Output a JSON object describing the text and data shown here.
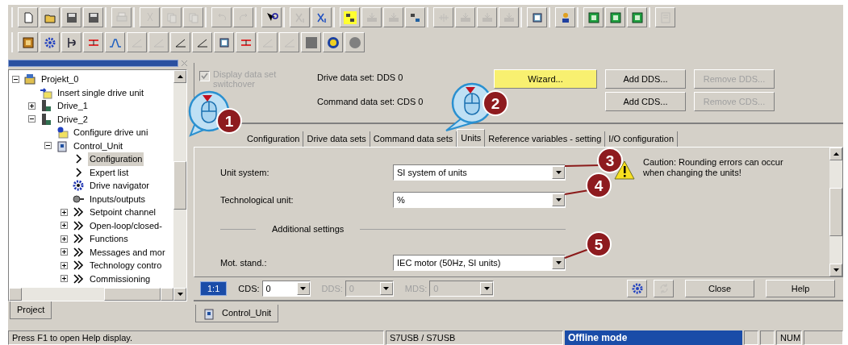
{
  "toolbars": [
    {
      "groups": [
        [
          {
            "kind": "new",
            "disabled": false
          },
          {
            "kind": "open",
            "disabled": false
          },
          {
            "kind": "save",
            "disabled": false
          },
          {
            "kind": "saveall",
            "disabled": false
          }
        ],
        [
          {
            "kind": "print",
            "disabled": true
          }
        ],
        [
          {
            "kind": "cut",
            "disabled": true
          },
          {
            "kind": "copy",
            "disabled": true
          },
          {
            "kind": "paste",
            "disabled": true
          }
        ],
        [
          {
            "kind": "undo",
            "disabled": true
          },
          {
            "kind": "redo",
            "disabled": true
          }
        ],
        [
          {
            "kind": "help",
            "disabled": false
          }
        ],
        [
          {
            "kind": "xi",
            "disabled": true
          },
          {
            "kind": "xe",
            "disabled": false
          }
        ],
        [
          {
            "kind": "connect",
            "disabled": false
          },
          {
            "kind": "download",
            "disabled": true
          },
          {
            "kind": "upload",
            "disabled": true
          },
          {
            "kind": "online",
            "disabled": false
          }
        ],
        [
          {
            "kind": "pins",
            "disabled": true
          },
          {
            "kind": "download",
            "disabled": true
          },
          {
            "kind": "upload",
            "disabled": true
          },
          {
            "kind": "download",
            "disabled": true
          }
        ],
        [
          {
            "kind": "chip",
            "disabled": false
          }
        ],
        [
          {
            "kind": "person",
            "disabled": false
          }
        ],
        [
          {
            "kind": "green",
            "disabled": false
          },
          {
            "kind": "green",
            "disabled": false
          },
          {
            "kind": "green",
            "disabled": false
          }
        ],
        [
          {
            "kind": "panel",
            "disabled": true
          }
        ]
      ]
    },
    {
      "groups": [
        [
          {
            "kind": "module",
            "disabled": false
          },
          {
            "kind": "gear",
            "disabled": false
          },
          {
            "kind": "valve",
            "disabled": false
          },
          {
            "kind": "redbar",
            "disabled": false
          },
          {
            "kind": "trapezoid",
            "disabled": false
          },
          {
            "kind": "ramp",
            "disabled": true
          },
          {
            "kind": "ramp",
            "disabled": true
          },
          {
            "kind": "ramp",
            "disabled": false
          },
          {
            "kind": "ramp",
            "disabled": false
          },
          {
            "kind": "chip",
            "disabled": false
          },
          {
            "kind": "redbar",
            "disabled": false
          },
          {
            "kind": "ramp",
            "disabled": true
          },
          {
            "kind": "ramp",
            "disabled": true
          },
          {
            "kind": "square",
            "disabled": false
          },
          {
            "kind": "motor",
            "disabled": false
          },
          {
            "kind": "circle",
            "disabled": false
          }
        ]
      ]
    }
  ],
  "project_tree": {
    "items": [
      {
        "label": "Projekt_0",
        "kind": "project",
        "selected": false,
        "expanded": true,
        "children": [
          {
            "label": "Insert single drive unit",
            "kind": "insert",
            "selected": false
          },
          {
            "label": "Drive_1",
            "kind": "drive",
            "selected": false,
            "expanded": false
          },
          {
            "label": "Drive_2",
            "kind": "drive",
            "selected": false,
            "expanded": true,
            "children": [
              {
                "label": "Configure drive uni",
                "kind": "configure",
                "selected": false
              },
              {
                "label": "Control_Unit",
                "kind": "control",
                "selected": false,
                "expanded": true,
                "children": [
                  {
                    "label": "Configuration",
                    "kind": "arrow",
                    "selected": true
                  },
                  {
                    "label": "Expert list",
                    "kind": "arrow",
                    "selected": false
                  },
                  {
                    "label": "Drive navigator",
                    "kind": "navigator",
                    "selected": false
                  },
                  {
                    "label": "Inputs/outputs",
                    "kind": "io",
                    "selected": false
                  },
                  {
                    "label": "Setpoint channel",
                    "kind": "double",
                    "selected": false,
                    "expanded": false
                  },
                  {
                    "label": "Open-loop/closed-",
                    "kind": "double",
                    "selected": false,
                    "expanded": false
                  },
                  {
                    "label": "Functions",
                    "kind": "double",
                    "selected": false,
                    "expanded": false
                  },
                  {
                    "label": "Messages and mor",
                    "kind": "double",
                    "selected": false,
                    "expanded": false
                  },
                  {
                    "label": "Technology contro",
                    "kind": "double",
                    "selected": false,
                    "expanded": false
                  },
                  {
                    "label": "Commissioning",
                    "kind": "double",
                    "selected": false,
                    "expanded": false
                  }
                ]
              }
            ]
          }
        ]
      }
    ]
  },
  "left_tabs": [
    {
      "label": "Project",
      "selected": true
    }
  ],
  "data_sets": {
    "switchover": {
      "label": "Display data set switchover",
      "checked": true,
      "disabled": true
    },
    "drive_data_set": "Drive data set: DDS 0",
    "command_data_set": "Command data set: CDS 0",
    "buttons": [
      {
        "label": "Wizard...",
        "highlighted": true,
        "disabled": false
      },
      {
        "label": "Add DDS...",
        "highlighted": false,
        "disabled": false
      },
      {
        "label": "Remove DDS...",
        "highlighted": false,
        "disabled": true
      },
      {
        "label": "Add CDS...",
        "highlighted": false,
        "disabled": false
      },
      {
        "label": "Remove CDS...",
        "highlighted": false,
        "disabled": true
      }
    ]
  },
  "tabs": [
    {
      "label": "Configuration",
      "selected": false
    },
    {
      "label": "Drive data sets",
      "selected": false
    },
    {
      "label": "Command data sets",
      "selected": false
    },
    {
      "label": "Units",
      "selected": true
    },
    {
      "label": "Reference variables - setting",
      "selected": false
    },
    {
      "label": "I/O configuration",
      "selected": false
    }
  ],
  "units": {
    "fields": [
      {
        "label": "Unit system:",
        "value": "SI system of units"
      },
      {
        "label": "Technological unit:",
        "value": "%"
      }
    ],
    "section": "Additional settings",
    "fields_2": [
      {
        "label": "Mot. stand.:",
        "value": "IEC motor (50Hz, SI units)"
      }
    ],
    "caution": "Caution: Rounding errors can occur when changing the units!"
  },
  "bottom_bar": {
    "ratio": "1:1",
    "selectors": [
      {
        "label": "CDS:",
        "value": "0",
        "disabled": false
      },
      {
        "label": "DDS:",
        "value": "0",
        "disabled": true
      },
      {
        "label": "MDS:",
        "value": "0",
        "disabled": true
      }
    ],
    "icon_buttons": [
      {
        "kind": "gear",
        "disabled": false
      },
      {
        "kind": "refresh",
        "disabled": true
      }
    ],
    "buttons": [
      "Close",
      "Help"
    ]
  },
  "document_tabs": [
    {
      "label": "Control_Unit",
      "selected": true
    }
  ],
  "status_bar": {
    "message": "Press F1 to open Help display.",
    "connection": "S7USB / S7USB",
    "mode": "Offline mode",
    "indicator": "NUM"
  },
  "callouts": [
    {
      "number": "1",
      "kind": "mouse"
    },
    {
      "number": "2",
      "kind": "mouse"
    },
    {
      "number": "3",
      "kind": "badge"
    },
    {
      "number": "4",
      "kind": "badge"
    },
    {
      "number": "5",
      "kind": "badge"
    }
  ]
}
